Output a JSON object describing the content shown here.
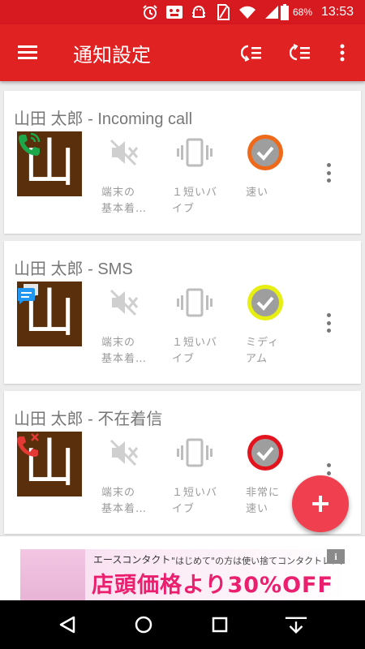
{
  "status_bar": {
    "battery_percent": "68%",
    "time": "13:53",
    "icons": [
      "alarm-icon",
      "app-notification-icon",
      "android-debug-icon",
      "no-sim-icon",
      "wifi-icon",
      "signal-icon",
      "battery-icon"
    ]
  },
  "app_bar": {
    "title": "通知設定",
    "actions": [
      "menu-icon",
      "collapse-list-icon",
      "expand-list-icon",
      "overflow-menu-icon"
    ]
  },
  "cards": [
    {
      "title": "山田 太郎 - Incoming call",
      "avatar_text": "山",
      "badge": "phone-icon",
      "options": [
        {
          "icon": "mute-icon",
          "label_lines": [
            "端末の",
            "基本着…"
          ]
        },
        {
          "icon": "vibrate-icon",
          "label_lines": [
            "１短いバ",
            "イブ"
          ]
        },
        {
          "icon": "check-icon",
          "color": "#ee6a1a",
          "label_lines": [
            "速い"
          ]
        }
      ]
    },
    {
      "title": "山田 太郎 - SMS",
      "avatar_text": "山",
      "badge": "message-icon",
      "options": [
        {
          "icon": "mute-icon",
          "label_lines": [
            "端末の",
            "基本着…"
          ]
        },
        {
          "icon": "vibrate-icon",
          "label_lines": [
            "１短いバ",
            "イブ"
          ]
        },
        {
          "icon": "check-icon",
          "color": "#e6ee12",
          "label_lines": [
            "ミディ",
            "アム"
          ]
        }
      ]
    },
    {
      "title": "山田 太郎 - 不在着信",
      "avatar_text": "山",
      "badge": "missed-call-icon",
      "options": [
        {
          "icon": "mute-icon",
          "label_lines": [
            "端末の",
            "基本着…"
          ]
        },
        {
          "icon": "vibrate-icon",
          "label_lines": [
            "１短いバ",
            "イブ"
          ]
        },
        {
          "icon": "check-icon",
          "color": "#e4141e",
          "label_lines": [
            "非常に",
            "速い"
          ]
        }
      ]
    }
  ],
  "fab": {
    "icon": "plus-icon",
    "color": "#f04050"
  },
  "ad": {
    "brand": "エースコンタクト",
    "catch": "\"はじめて\"の方は使い捨てコンタクトレンズを!",
    "promo": "店頭価格より30%OFF",
    "info": "i"
  },
  "nav_bar": {
    "buttons": [
      "back-icon",
      "home-icon",
      "recents-icon",
      "hide-keyboard-icon"
    ]
  },
  "colors": {
    "status_bar": "#d71920",
    "app_bar": "#e02222",
    "card_bg": "#ffffff",
    "background": "#ececec"
  }
}
